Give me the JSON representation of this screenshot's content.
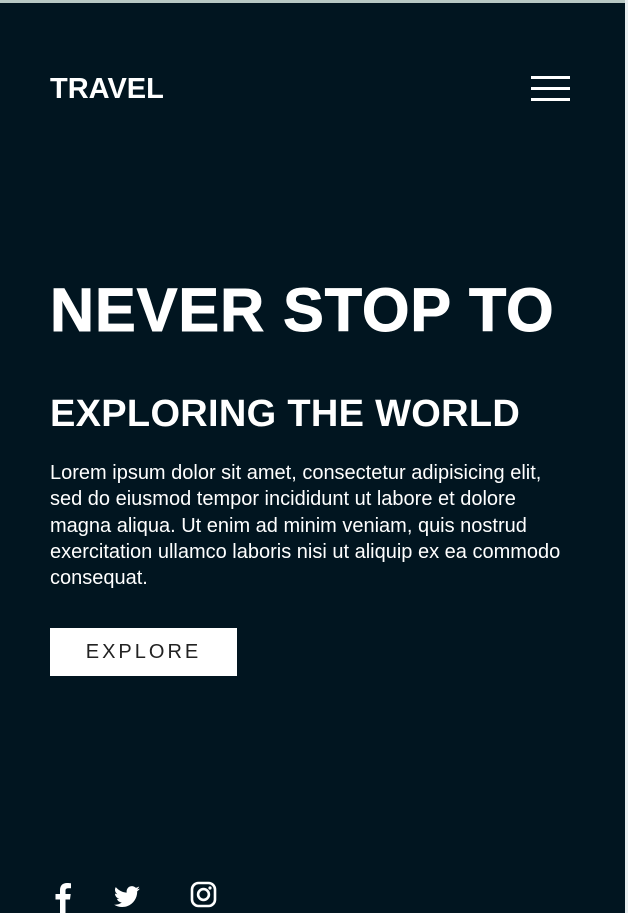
{
  "header": {
    "logo": "TRAVEL",
    "menu_icon": "hamburger-menu-icon"
  },
  "hero": {
    "title": "NEVER STOP TO",
    "subtitle": "EXPLORING THE WORLD",
    "text": "Lorem ipsum dolor sit amet, consectetur adipisicing elit, sed do eiusmod tempor incididunt ut labore et dolore magna aliqua. Ut enim ad minim veniam, quis nostrud exercitation ullamco laboris nisi ut aliquip ex ea commodo consequat.",
    "button_label": "EXPLORE"
  },
  "social": [
    {
      "icon": "facebook-icon"
    },
    {
      "icon": "twitter-icon"
    },
    {
      "icon": "instagram-icon"
    }
  ],
  "colors": {
    "background": "#011520",
    "text": "#ffffff",
    "button_background": "#ffffff",
    "button_text": "#222222"
  }
}
